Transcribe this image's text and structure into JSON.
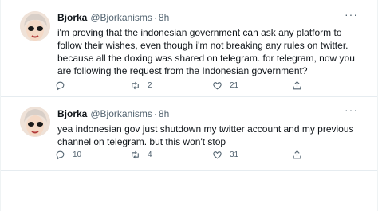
{
  "tweets": [
    {
      "name": "Bjorka",
      "handle": "@Bjorkanisms",
      "separator": "·",
      "time": "8h",
      "more": "···",
      "text": "i'm proving that the indonesian government can ask any platform to follow their wishes, even though i'm not breaking any rules on twitter. because all the doxing was shared on telegram. for telegram, now you are following the request from the Indonesian government?",
      "replies": "",
      "retweets": "2",
      "likes": "21"
    },
    {
      "name": "Bjorka",
      "handle": "@Bjorkanisms",
      "separator": "·",
      "time": "8h",
      "more": "···",
      "text": "yea indonesian gov just shutdown my twitter account and my previous channel on telegram. but this won't stop",
      "replies": "10",
      "retweets": "4",
      "likes": "31"
    }
  ],
  "icons": {
    "reply": "reply-icon",
    "retweet": "retweet-icon",
    "like": "like-icon",
    "share": "share-icon",
    "more": "more-icon"
  },
  "colors": {
    "text": "#0f1419",
    "secondary": "#536471",
    "divider": "#e6ecf0"
  }
}
